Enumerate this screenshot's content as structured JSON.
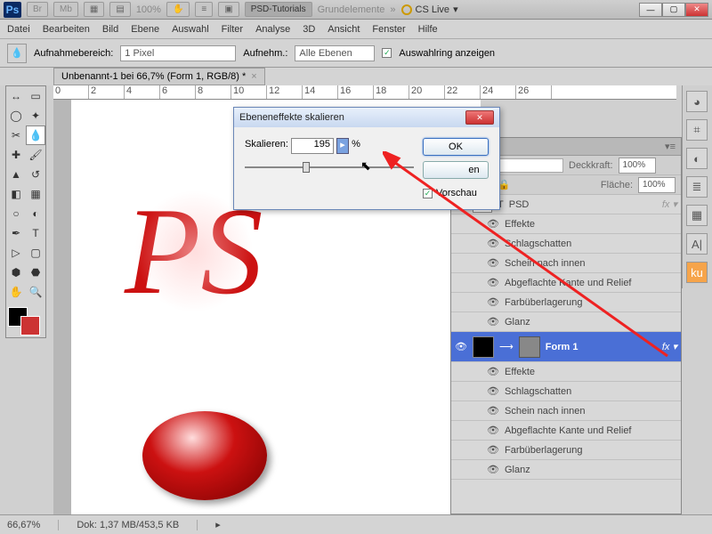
{
  "top": {
    "zoom": "100%",
    "psd_tut": "PSD-Tutorials",
    "grund": "Grundelemente",
    "cslive": "CS Live",
    "br": "Br",
    "mb": "Mb"
  },
  "menu": [
    "Datei",
    "Bearbeiten",
    "Bild",
    "Ebene",
    "Auswahl",
    "Filter",
    "Analyse",
    "3D",
    "Ansicht",
    "Fenster",
    "Hilfe"
  ],
  "opt": {
    "aufnahme": "Aufnahmebereich:",
    "px": "1 Pixel",
    "aufnm": "Aufnehm.:",
    "alle": "Alle Ebenen",
    "ring": "Auswahlring anzeigen"
  },
  "tab": {
    "title": "Unbenannt-1 bei 66,7% (Form 1, RGB/8) *"
  },
  "ruler": [
    "0",
    "2",
    "4",
    "6",
    "8",
    "10",
    "12",
    "14",
    "16",
    "18",
    "20",
    "22",
    "24",
    "26"
  ],
  "dialog": {
    "title": "Ebeneneffekte skalieren",
    "label": "Skalieren:",
    "value": "195",
    "pct": "%",
    "ok": "OK",
    "cancel_suffix": "en",
    "preview": "Vorschau"
  },
  "panel": {
    "deckkraft": "Deckkraft:",
    "flache": "Fläche:",
    "pct": "100%"
  },
  "layers": {
    "psd": "PSD",
    "effekte": "Effekte",
    "schlag": "Schlagschatten",
    "schein": "Schein nach innen",
    "abgef": "Abgeflachte Kante und Relief",
    "farb": "Farbüberlagerung",
    "glanz": "Glanz",
    "form1": "Form 1"
  },
  "status": {
    "zoom": "66,67%",
    "dok": "Dok: 1,37 MB/453,5 KB"
  },
  "art": "PS"
}
